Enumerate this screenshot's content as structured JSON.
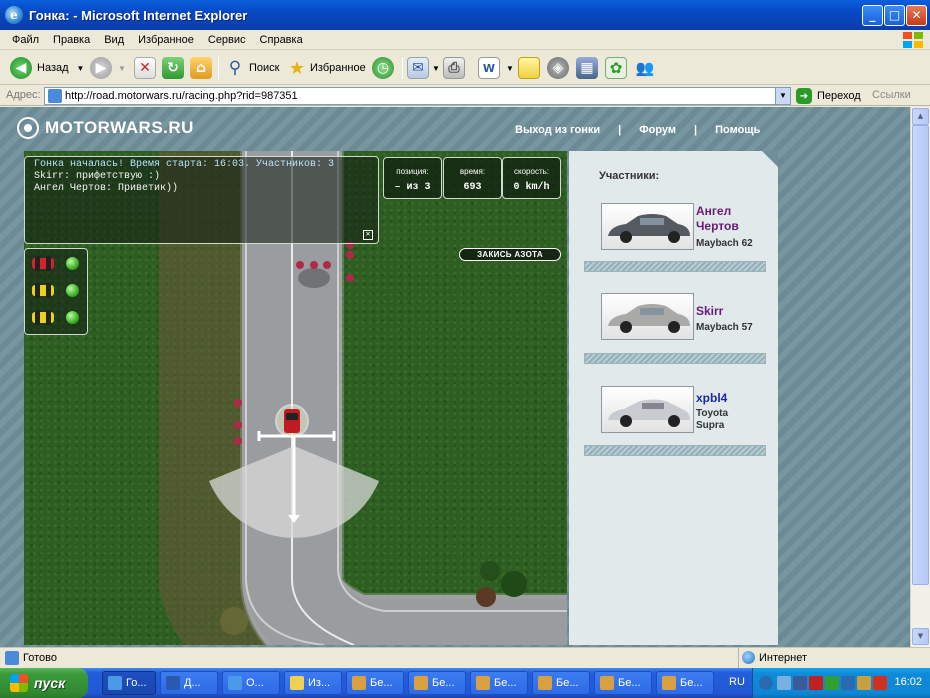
{
  "window": {
    "title": "Гонка: - Microsoft Internet Explorer"
  },
  "menu": [
    "Файл",
    "Правка",
    "Вид",
    "Избранное",
    "Сервис",
    "Справка"
  ],
  "toolbar": {
    "back": "Назад",
    "search": "Поиск",
    "favorites": "Избранное"
  },
  "address": {
    "label": "Адрес:",
    "url": "http://road.motorwars.ru/racing.php?rid=987351",
    "go": "Переход",
    "links": "Ссылки"
  },
  "site": {
    "logo": "MOTORWARS.RU",
    "nav": [
      "Выход из гонки",
      "|",
      "Форум",
      "|",
      "Помощь"
    ]
  },
  "chat": [
    "Гонка началась! Время старта: 16:03. Участников: 3",
    "Skirr: прифетствую :)",
    "Ангел Чертов: Приветик))"
  ],
  "stats": {
    "position": {
      "label": "позиция:",
      "value": "– из 3"
    },
    "time": {
      "label": "время:",
      "value": "693"
    },
    "speed": {
      "label": "скорость:",
      "value": "0 km/h"
    }
  },
  "nitro_label": "ЗАКИСЬ АЗОТА",
  "racers": [
    {
      "car_color": "#d8212c"
    },
    {
      "car_color": "#e8d21a"
    },
    {
      "car_color": "#e8d21a"
    }
  ],
  "participants": {
    "title": "Участники:",
    "list": [
      {
        "name": "Ангел Чертов",
        "model": "Maybach 62",
        "name_color": "#6a1a78",
        "car_color": "#555a60"
      },
      {
        "name": "Skirr",
        "model": "Maybach 57",
        "name_color": "#6a1a78",
        "car_color": "#a9aaa8"
      },
      {
        "name": "xpbl4",
        "model": "Toyota Supra",
        "name_color": "#1a2aa0",
        "car_color": "#c8ccd0"
      }
    ]
  },
  "status": {
    "text": "Готово",
    "zone": "Интернет"
  },
  "taskbar": {
    "start": "пуск",
    "tasks": [
      "Го...",
      "Д...",
      "О...",
      "Из...",
      "Бе...",
      "Бе...",
      "Бе...",
      "Бе...",
      "Бе...",
      "Бе..."
    ],
    "lang": "RU",
    "clock": "16:02"
  }
}
